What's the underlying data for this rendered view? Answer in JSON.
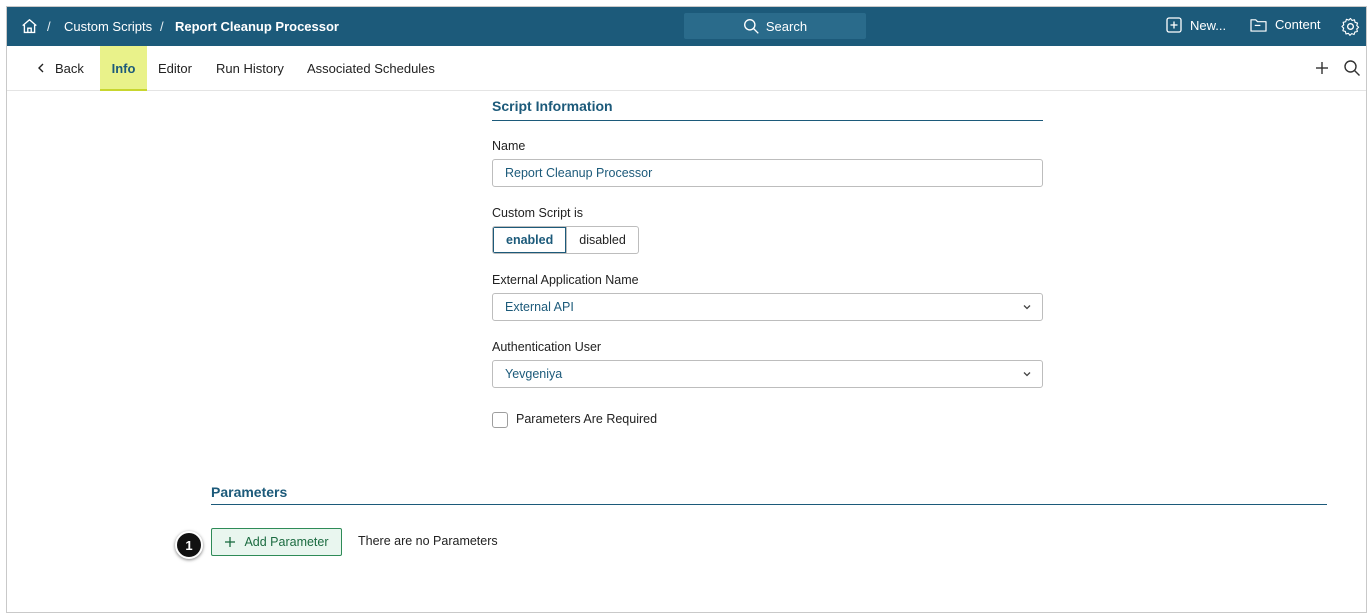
{
  "topbar": {
    "breadcrumb": [
      "Custom Scripts",
      "Report Cleanup Processor"
    ],
    "separator": "/",
    "search_label": "Search",
    "new_label": "New...",
    "content_label": "Content"
  },
  "tabs": {
    "back": "Back",
    "items": [
      "Info",
      "Editor",
      "Run History",
      "Associated Schedules"
    ],
    "active": "Info"
  },
  "script_info": {
    "title": "Script Information",
    "name_label": "Name",
    "name_value": "Report Cleanup Processor",
    "status_label": "Custom Script is",
    "status_options": [
      "enabled",
      "disabled"
    ],
    "status_selected": "enabled",
    "ext_app_label": "External Application Name",
    "ext_app_value": "External API",
    "auth_user_label": "Authentication User",
    "auth_user_value": "Yevgeniya",
    "params_required_label": "Parameters Are Required",
    "params_required_checked": false
  },
  "parameters": {
    "title": "Parameters",
    "add_label": "Add Parameter",
    "empty_text": "There are no Parameters"
  },
  "callout": {
    "number": "1"
  },
  "colors": {
    "brand": "#1c5a7a",
    "active_tab": "#e9f28a",
    "add_button": "#2e8b57"
  }
}
